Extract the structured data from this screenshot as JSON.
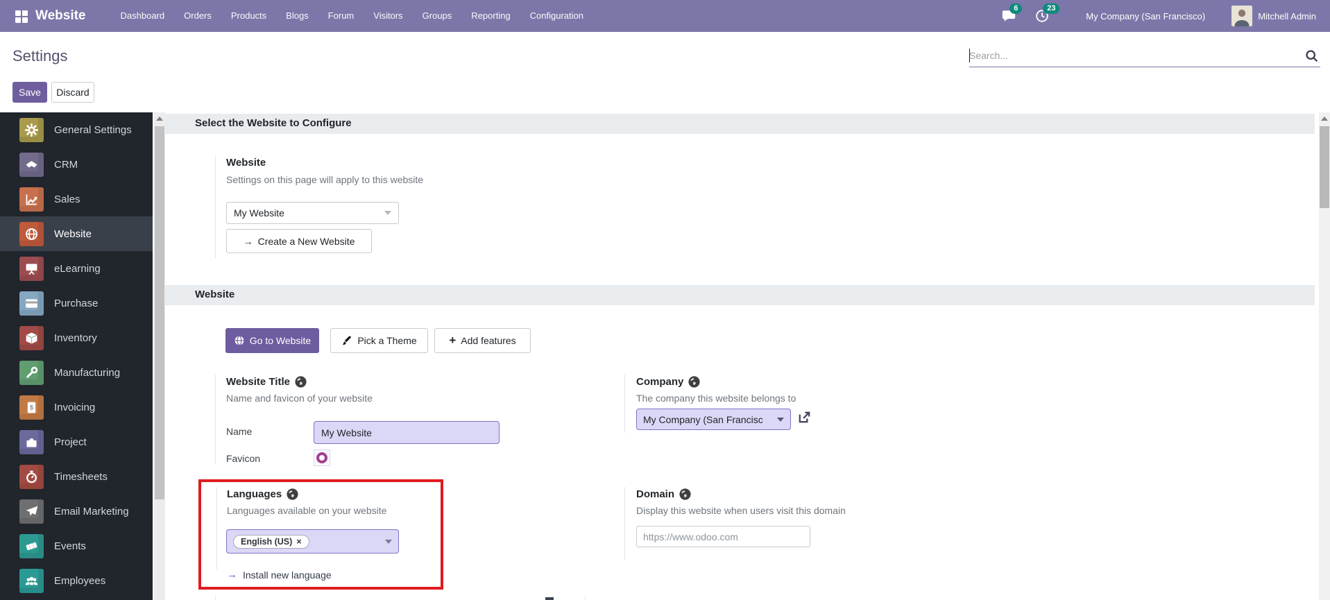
{
  "colors": {
    "navbar_bg": "#7c76a9",
    "badge_teal": "#0e8a7d",
    "primary_purple": "#6e5e9e",
    "highlight_red": "#e01b1f",
    "field_lavender_bg": "#dbd7f6",
    "field_lavender_border": "#7d73c4",
    "sidebar_bg": "#21252c",
    "section_band_bg": "#e9ecef"
  },
  "navbar": {
    "brand": "Website",
    "menu": [
      "Dashboard",
      "Orders",
      "Products",
      "Blogs",
      "Forum",
      "Visitors",
      "Groups",
      "Reporting",
      "Configuration"
    ],
    "messages_badge": "6",
    "activities_badge": "23",
    "company": "My Company (San Francisco)",
    "user": "Mitchell Admin"
  },
  "header": {
    "title": "Settings",
    "save_label": "Save",
    "discard_label": "Discard",
    "search_placeholder": "Search..."
  },
  "sidebar": {
    "items": [
      {
        "label": "General Settings",
        "icon": "gear",
        "color": "#a89b4c"
      },
      {
        "label": "CRM",
        "icon": "handshake",
        "color": "#716b8c"
      },
      {
        "label": "Sales",
        "icon": "chart",
        "color": "#c8704e"
      },
      {
        "label": "Website",
        "icon": "globe",
        "color": "#bf5a3b",
        "selected": true
      },
      {
        "label": "eLearning",
        "icon": "presentation",
        "color": "#9c4d52"
      },
      {
        "label": "Purchase",
        "icon": "card",
        "color": "#85a8c2"
      },
      {
        "label": "Inventory",
        "icon": "box",
        "color": "#a14a46"
      },
      {
        "label": "Manufacturing",
        "icon": "wrench",
        "color": "#609e70"
      },
      {
        "label": "Invoicing",
        "icon": "invoice",
        "color": "#c27a44"
      },
      {
        "label": "Project",
        "icon": "puzzle",
        "color": "#6c699c"
      },
      {
        "label": "Timesheets",
        "icon": "stopwatch",
        "color": "#a34a42"
      },
      {
        "label": "Email Marketing",
        "icon": "plane",
        "color": "#6f6f72"
      },
      {
        "label": "Events",
        "icon": "ticket",
        "color": "#2d9a92"
      },
      {
        "label": "Employees",
        "icon": "users",
        "color": "#2b9a94"
      }
    ]
  },
  "main": {
    "section_select": {
      "title": "Select the Website to Configure",
      "website_label": "Website",
      "website_help": "Settings on this page will apply to this website",
      "website_value": "My Website",
      "create_label": "Create a New Website",
      "create_arrow": "→"
    },
    "section_website": {
      "title": "Website",
      "goto_label": "Go to Website",
      "theme_label": "Pick a Theme",
      "features_label": "Add features",
      "features_plus": "+",
      "website_title": {
        "label": "Website Title",
        "help": "Name and favicon of your website",
        "name_label": "Name",
        "name_value": "My Website",
        "favicon_label": "Favicon"
      },
      "company": {
        "label": "Company",
        "help": "The company this website belongs to",
        "value": "My Company (San Francisc"
      },
      "languages": {
        "label": "Languages",
        "help": "Languages available on your website",
        "tag": "English (US)",
        "tag_remove": "×",
        "install_arrow": "→",
        "install_label": "Install new language"
      },
      "domain": {
        "label": "Domain",
        "help": "Display this website when users visit this domain",
        "placeholder": "https://www.odoo.com"
      }
    }
  }
}
